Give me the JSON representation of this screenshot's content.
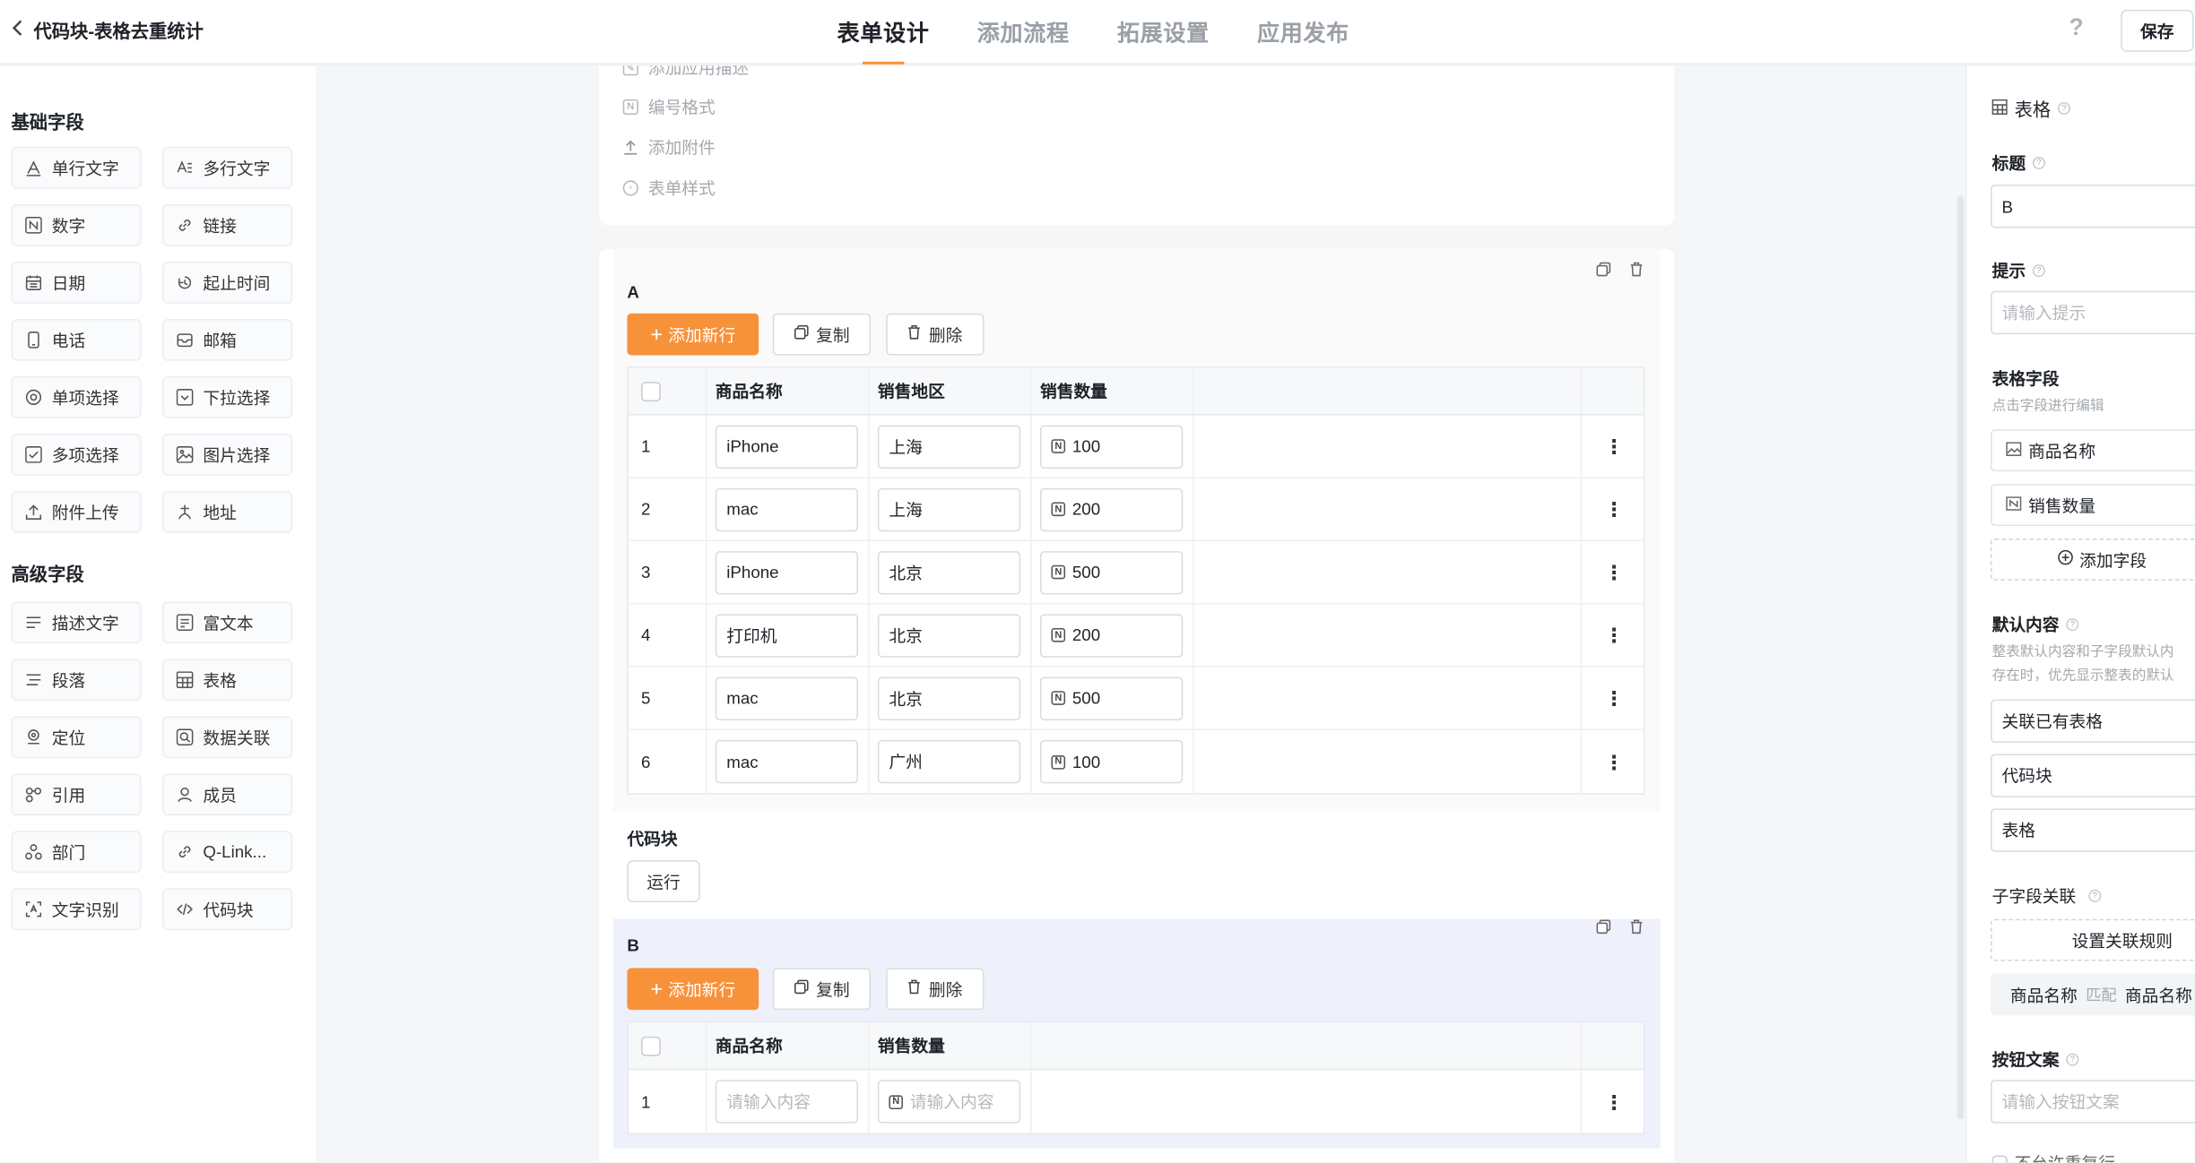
{
  "header": {
    "back_title": "代码块-表格去重统计",
    "tabs": [
      "表单设计",
      "添加流程",
      "拓展设置",
      "应用发布"
    ],
    "help": "?",
    "save_label": "保存"
  },
  "left": {
    "basic_title": "基础字段",
    "basic_fields": [
      {
        "label": "单行文字",
        "icon": "text-icon"
      },
      {
        "label": "多行文字",
        "icon": "multiline-text-icon"
      },
      {
        "label": "数字",
        "icon": "number-icon"
      },
      {
        "label": "链接",
        "icon": "link-icon"
      },
      {
        "label": "日期",
        "icon": "calendar-icon"
      },
      {
        "label": "起止时间",
        "icon": "time-range-icon"
      },
      {
        "label": "电话",
        "icon": "phone-icon"
      },
      {
        "label": "邮箱",
        "icon": "mail-icon"
      },
      {
        "label": "单项选择",
        "icon": "radio-icon"
      },
      {
        "label": "下拉选择",
        "icon": "dropdown-icon"
      },
      {
        "label": "多项选择",
        "icon": "checkbox-icon"
      },
      {
        "label": "图片选择",
        "icon": "image-icon"
      },
      {
        "label": "附件上传",
        "icon": "upload-icon"
      },
      {
        "label": "地址",
        "icon": "location-pin-icon"
      }
    ],
    "advanced_title": "高级字段",
    "advanced_fields": [
      {
        "label": "描述文字",
        "icon": "description-icon"
      },
      {
        "label": "富文本",
        "icon": "rich-text-icon"
      },
      {
        "label": "段落",
        "icon": "paragraph-icon"
      },
      {
        "label": "表格",
        "icon": "table-icon"
      },
      {
        "label": "定位",
        "icon": "locate-icon"
      },
      {
        "label": "数据关联",
        "icon": "data-link-icon"
      },
      {
        "label": "引用",
        "icon": "reference-icon"
      },
      {
        "label": "成员",
        "icon": "member-icon"
      },
      {
        "label": "部门",
        "icon": "department-icon"
      },
      {
        "label": "Q-Link...",
        "icon": "qlink-icon"
      },
      {
        "label": "文字识别",
        "icon": "ocr-icon"
      },
      {
        "label": "代码块",
        "icon": "code-icon"
      }
    ]
  },
  "canvas": {
    "meta_items": [
      "添加应用描述",
      "编号格式",
      "添加附件",
      "表单样式"
    ],
    "table_a": {
      "label": "A",
      "add_row": "添加新行",
      "copy": "复制",
      "delete": "删除",
      "headers": [
        "商品名称",
        "销售地区",
        "销售数量"
      ],
      "rows": [
        {
          "n": "1",
          "name": "iPhone",
          "region": "上海",
          "qty": "100"
        },
        {
          "n": "2",
          "name": "mac",
          "region": "上海",
          "qty": "200"
        },
        {
          "n": "3",
          "name": "iPhone",
          "region": "北京",
          "qty": "500"
        },
        {
          "n": "4",
          "name": "打印机",
          "region": "北京",
          "qty": "200"
        },
        {
          "n": "5",
          "name": "mac",
          "region": "北京",
          "qty": "500"
        },
        {
          "n": "6",
          "name": "mac",
          "region": "广州",
          "qty": "100"
        }
      ]
    },
    "code_block": {
      "label": "代码块",
      "run": "运行"
    },
    "table_b": {
      "label": "B",
      "add_row": "添加新行",
      "copy": "复制",
      "delete": "删除",
      "headers": [
        "商品名称",
        "销售数量"
      ],
      "rows": [
        {
          "n": "1",
          "name_placeholder": "请输入内容",
          "qty_placeholder": "请输入内容"
        }
      ]
    }
  },
  "right": {
    "panel_title": "表格",
    "title_label": "标题",
    "title_value": "B",
    "hint_label": "提示",
    "hint_placeholder": "请输入提示",
    "fields_label": "表格字段",
    "fields_hint": "点击字段进行编辑",
    "fields": [
      "商品名称",
      "销售数量"
    ],
    "add_field": "添加字段",
    "default_label": "默认内容",
    "default_hint_1": "整表默认内容和子字段默认内",
    "default_hint_2": "存在时，优先显示整表的默认",
    "default_options": [
      "关联已有表格",
      "代码块",
      "表格"
    ],
    "sub_link_label": "子字段关联",
    "sub_link_button": "设置关联规则",
    "match_left": "商品名称",
    "match_word": "匹配",
    "match_right": "商品名称",
    "button_text_label": "按钮文案",
    "button_text_placeholder": "请输入按钮文案",
    "bottom_partial": "不允许重复行"
  },
  "colors": {
    "accent": "#f7923b",
    "selected_block": "#eef1fb"
  }
}
